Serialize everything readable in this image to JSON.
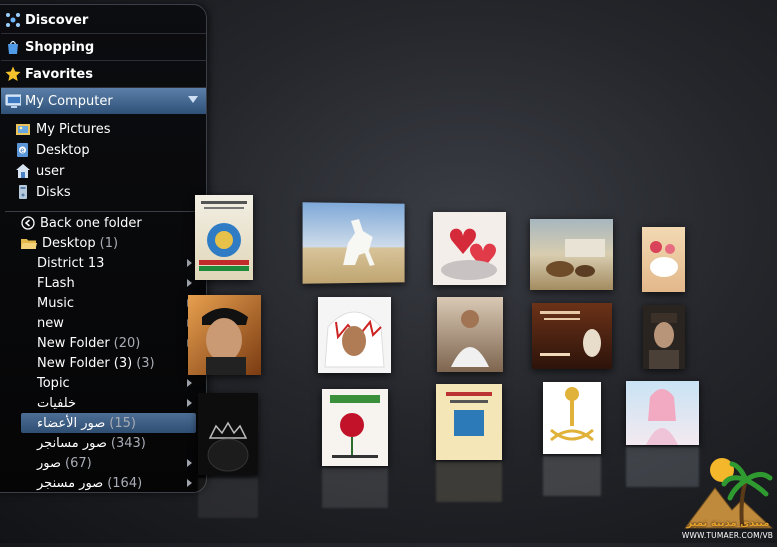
{
  "sidebar": {
    "categories": [
      {
        "label": "Discover",
        "icon": "discover-icon"
      },
      {
        "label": "Shopping",
        "icon": "shopping-bag-icon"
      },
      {
        "label": "Favorites",
        "icon": "star-icon"
      },
      {
        "label": "My Computer",
        "icon": "monitor-icon"
      }
    ],
    "locations": [
      {
        "label": "My Pictures",
        "icon": "pictures-folder-icon"
      },
      {
        "label": "Desktop",
        "icon": "desktop-icon"
      },
      {
        "label": "user",
        "icon": "user-home-icon"
      },
      {
        "label": "Disks",
        "icon": "disks-icon"
      }
    ],
    "back_label": "Back one folder",
    "current_folder": {
      "label": "Desktop",
      "count": "(1)"
    },
    "folders": [
      {
        "label": "District 13",
        "count": "",
        "arrow": true
      },
      {
        "label": "FLash",
        "count": "",
        "arrow": true
      },
      {
        "label": "Music",
        "count": "",
        "arrow": true
      },
      {
        "label": "new",
        "count": "",
        "arrow": true
      },
      {
        "label": "New Folder",
        "count": "(20)",
        "arrow": true
      },
      {
        "label": "New Folder (3)",
        "count": "(3)",
        "arrow": false
      },
      {
        "label": "Topic",
        "count": "",
        "arrow": true
      },
      {
        "label": "خلفيات",
        "count": "",
        "arrow": true
      },
      {
        "label": "صور الأعضاء",
        "count": "(15)",
        "arrow": false
      },
      {
        "label": "صور مسانجر",
        "count": "(343)",
        "arrow": false
      },
      {
        "label": "صور",
        "count": "(67)",
        "arrow": true
      },
      {
        "label": "صور مسنجر",
        "count": "(164)",
        "arrow": true
      }
    ],
    "selected_folder_index": 8
  },
  "logo": {
    "title": "منتدى مدينة تمير",
    "url": "WWW.TUMAER.COM/VB"
  },
  "colors": {
    "selection": "#3e6590",
    "bg": "#24262b"
  }
}
